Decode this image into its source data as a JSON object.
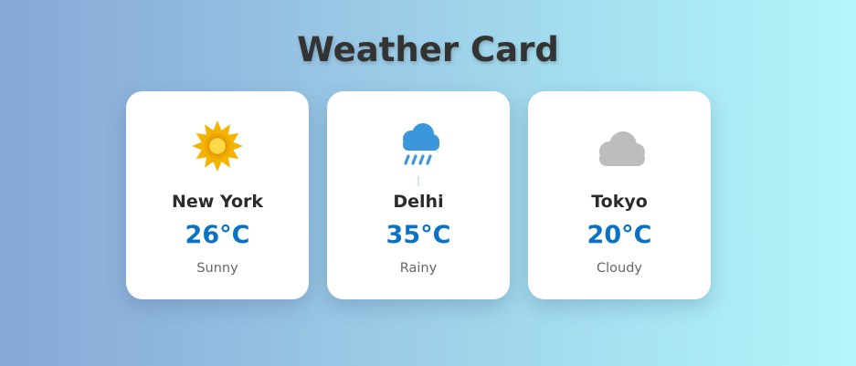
{
  "page": {
    "title": "Weather Card"
  },
  "cards": [
    {
      "city": "New York",
      "temperature": "26°C",
      "condition": "Sunny",
      "icon": "sun-icon"
    },
    {
      "city": "Delhi",
      "temperature": "35°C",
      "condition": "Rainy",
      "icon": "rain-cloud-icon"
    },
    {
      "city": "Tokyo",
      "temperature": "20°C",
      "condition": "Cloudy",
      "icon": "cloud-icon"
    }
  ],
  "colors": {
    "title": "#333333",
    "temperature": "#0a72c4",
    "sun": "#f5b301",
    "rain_cloud": "#3b96db",
    "cloud": "#bdbdbd"
  }
}
